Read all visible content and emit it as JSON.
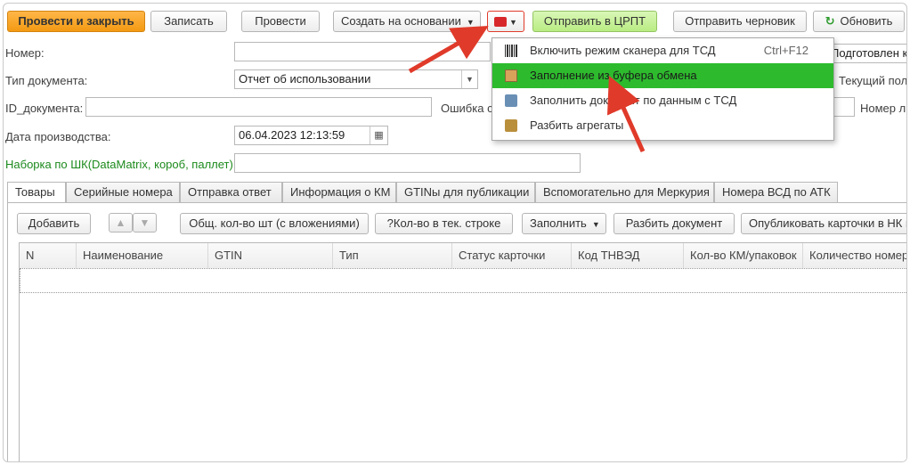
{
  "toolbar": {
    "post_close": "Провести и закрыть",
    "save": "Записать",
    "post": "Провести",
    "create_based": "Создать на основании",
    "send_crpt": "Отправить в ЦРПТ",
    "send_draft": "Отправить черновик",
    "refresh": "Обновить"
  },
  "form": {
    "number_label": "Номер:",
    "doc_type_label": "Тип документа:",
    "doc_type_value": "Отчет об использовании",
    "id_label": "ID_документа:",
    "error_label": "Ошибка с",
    "prod_date_label": "Дата производства:",
    "prod_date_value": "06.04.2023 12:13:59",
    "scan_label": "Наборка по ШК(DataMatrix, короб, паллет):",
    "prepared_label": "Подготовлен к",
    "current_user_label": "Текущий поль",
    "license_label": "Номер ли"
  },
  "menu": {
    "items": [
      {
        "label": "Включить режим сканера для ТСД",
        "shortcut": "Ctrl+F12"
      },
      {
        "label": "Заполнение из буфера обмена",
        "shortcut": ""
      },
      {
        "label": "Заполнить документ по данным с ТСД",
        "shortcut": ""
      },
      {
        "label": "Разбить агрегаты",
        "shortcut": ""
      }
    ]
  },
  "tabs": [
    "Товары",
    "Серийные номера",
    "Отправка ответ",
    "Информация о КМ",
    "GTINы для публикации",
    "Вспомогательно для Меркурия",
    "Номера ВСД по АТК"
  ],
  "tab_toolbar": {
    "add": "Добавить",
    "total_qty": "Общ. кол-во шт (с вложениями)",
    "qty_in_row": "?Кол-во в тек. строке",
    "fill": "Заполнить",
    "split_doc": "Разбить документ",
    "publish": "Опубликовать карточки в НК п"
  },
  "table": {
    "columns": [
      "N",
      "Наименование",
      "GTIN",
      "Тип",
      "Статус карточки",
      "Код ТНВЭД",
      "Кол-во КМ/упаковок",
      "Количество номеро"
    ]
  },
  "colors": {
    "primary_orange": "#f39a12",
    "send_green": "#b9ec83",
    "menu_highlight": "#2dbb2d",
    "annotation_red": "#e03a2a",
    "label_green": "#1c8a1c"
  }
}
